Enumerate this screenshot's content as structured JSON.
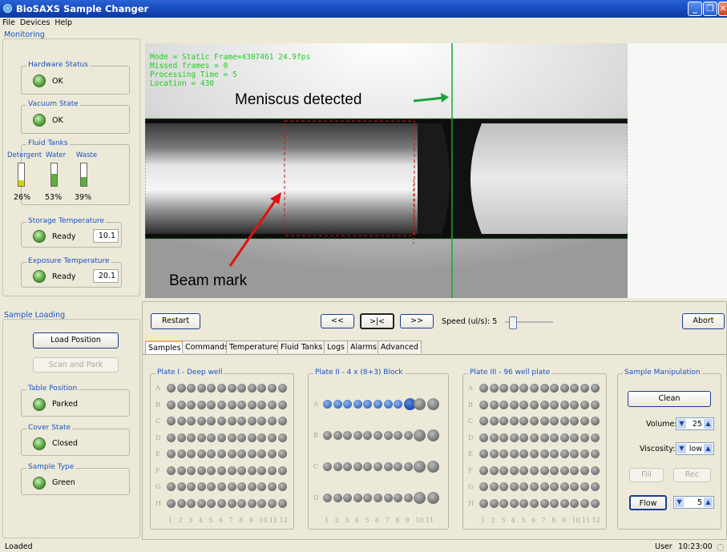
{
  "window": {
    "title": "BioSAXS Sample Changer"
  },
  "menu": [
    "File",
    "Devices",
    "Help"
  ],
  "monitoring": {
    "title": "Monitoring",
    "hardware_status": {
      "label": "Hardware Status",
      "value": "OK"
    },
    "vacuum_state": {
      "label": "Vacuum State",
      "value": "OK"
    },
    "fluid_tanks": {
      "label": "Fluid Tanks",
      "tanks": [
        {
          "name": "Detergent",
          "level": "26%",
          "fraction": 0.26,
          "color": "#d9d400"
        },
        {
          "name": "Water",
          "level": "53%",
          "fraction": 0.53,
          "color": "#5cb03a"
        },
        {
          "name": "Waste",
          "level": "39%",
          "fraction": 0.39,
          "color": "#5cb03a"
        }
      ]
    },
    "storage_temperature": {
      "label": "Storage Temperature",
      "status": "Ready",
      "value": "10.1"
    },
    "exposure_temperature": {
      "label": "Exposure Temperature",
      "status": "Ready",
      "value": "20.1"
    }
  },
  "sample_loading": {
    "title": "Sample Loading",
    "load_position": "Load Position",
    "scan_and_park": "Scan and Park",
    "table_position": {
      "label": "Table Position",
      "value": "Parked"
    },
    "cover_state": {
      "label": "Cover State",
      "value": "Closed"
    },
    "sample_type": {
      "label": "Sample Type",
      "value": "Green"
    }
  },
  "video": {
    "overlay": [
      "Mode = Static Frame=4307461 24.9fps",
      "Missed frames = 0",
      "Processing Time = 5",
      "Location = 430"
    ],
    "meniscus_label": "Meniscus detected",
    "beam_label": "Beam mark",
    "meniscus_color": "#1aa33a",
    "beam_color": "#e01010"
  },
  "controls": {
    "restart": "Restart",
    "rewind": "<<",
    "center": ">|<",
    "forward": ">>",
    "speed_label": "Speed (ul/s): 5",
    "speed_value": 5,
    "abort": "Abort"
  },
  "tabs": [
    "Samples",
    "Commands",
    "Temperature",
    "Fluid Tanks",
    "Logs",
    "Alarms",
    "Advanced"
  ],
  "plates": {
    "plate1": {
      "title": "Plate I - Deep well",
      "rows": [
        "A",
        "B",
        "C",
        "D",
        "E",
        "F",
        "G",
        "H"
      ],
      "cols": [
        "1",
        "2",
        "3",
        "4",
        "5",
        "6",
        "7",
        "8",
        "9",
        "10",
        "11",
        "12"
      ]
    },
    "plate2": {
      "title": "Plate II - 4 x (8+3) Block",
      "rows": [
        "A",
        "B",
        "C",
        "D"
      ],
      "cols": [
        "1",
        "2",
        "3",
        "4",
        "5",
        "6",
        "7",
        "8",
        "9",
        "10",
        "11"
      ]
    },
    "plate3": {
      "title": "Plate III - 96 well plate",
      "rows": [
        "A",
        "B",
        "C",
        "D",
        "E",
        "F",
        "G",
        "H"
      ],
      "cols": [
        "1",
        "2",
        "3",
        "4",
        "5",
        "6",
        "7",
        "8",
        "9",
        "10",
        "11",
        "12"
      ]
    }
  },
  "manipulation": {
    "title": "Sample Manipulation",
    "clean": "Clean",
    "volume_label": "Volume:",
    "volume": "25",
    "viscosity_label": "Viscosity:",
    "viscosity": "low",
    "fill": "Fill",
    "rec": "Rec",
    "flow": "Flow",
    "flow_value": "5"
  },
  "statusbar": {
    "left": "Loaded",
    "user": "User",
    "time": "10:23:00"
  }
}
